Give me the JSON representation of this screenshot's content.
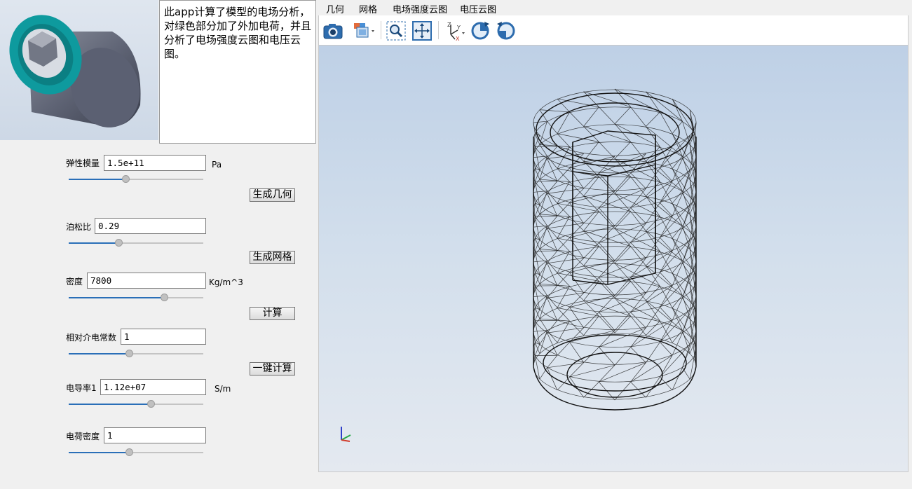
{
  "description": "此app计算了模型的电场分析，对绿色部分加了外加电荷，并且分析了电场强度云图和电压云图。",
  "params": {
    "modulus": {
      "label": "弹性模量",
      "value": "1.5e+11",
      "unit": "Pa",
      "slider": 0.42
    },
    "poisson": {
      "label": "泊松比",
      "value": "0.29",
      "unit": "",
      "slider": 0.37
    },
    "density": {
      "label": "密度",
      "value": "7800",
      "unit": "Kg/m^3",
      "slider": 0.71
    },
    "permittivity": {
      "label": "相对介电常数",
      "value": "1",
      "unit": "",
      "slider": 0.45
    },
    "conductivity": {
      "label": "电导率1",
      "value": "1.12e+07",
      "unit": "S/m",
      "slider": 0.61
    },
    "charge": {
      "label": "电荷密度",
      "value": "1",
      "unit": "",
      "slider": 0.45
    }
  },
  "buttons": {
    "gen_geometry": "生成几何",
    "gen_mesh": "生成网格",
    "compute": "计算",
    "one_click": "一键计算"
  },
  "tabs": [
    "几何",
    "网格",
    "电场强度云图",
    "电压云图"
  ],
  "toolbar": {
    "icons": [
      "camera-icon",
      "view-cube-icon",
      "zoom-window-icon",
      "fit-all-icon",
      "axis-orientation-icon",
      "rotate-cw-icon",
      "rotate-ccw-icon"
    ]
  },
  "colors": {
    "accent": "#2a6fb8",
    "model_teal": "#0e9a9e",
    "mesh_line": "#1e1e1e",
    "viewport_top": "#bed0e6",
    "viewport_bottom": "#e4e9f0"
  }
}
